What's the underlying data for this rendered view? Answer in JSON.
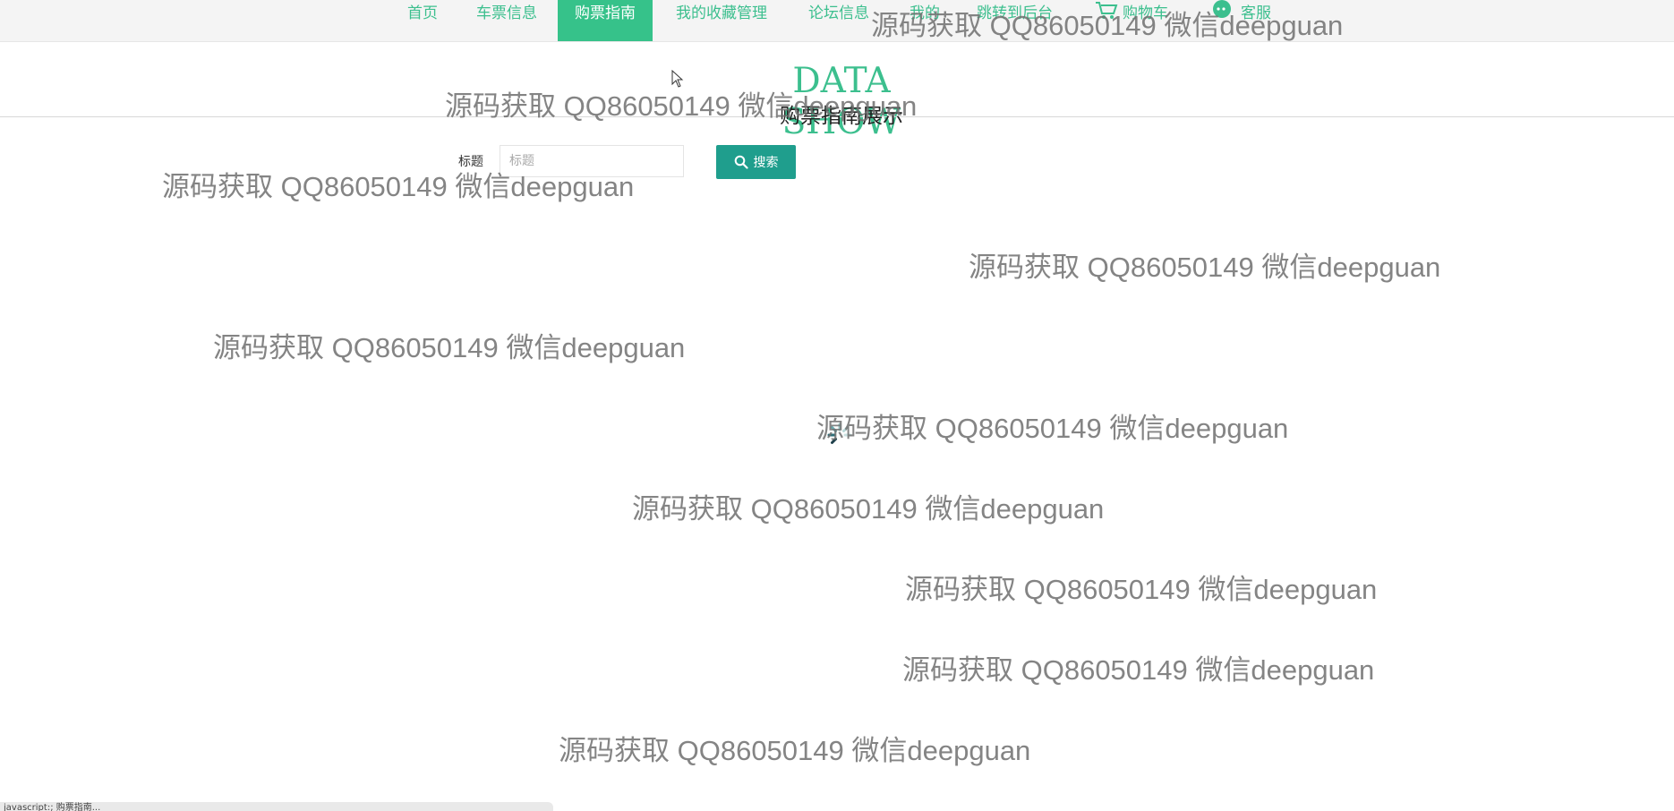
{
  "nav": {
    "items": [
      "首页",
      "车票信息",
      "购票指南",
      "我的收藏管理",
      "论坛信息",
      "我的",
      "跳转到后台"
    ],
    "active_index": 2,
    "cart_label": "购物车",
    "service_label": "客服"
  },
  "header": {
    "brand": "DATA SHOW",
    "subtitle": "购票指南展示"
  },
  "search": {
    "label": "标题",
    "placeholder": "标题",
    "button_label": "搜索"
  },
  "watermark": "源码获取 QQ86050149 微信deepguan",
  "statusbar": {
    "text": "javascript:; 购票指南..."
  },
  "colors": {
    "accent": "#3cbf8e",
    "active_tab": "#36c28a",
    "search_button": "#1f9e8d"
  }
}
